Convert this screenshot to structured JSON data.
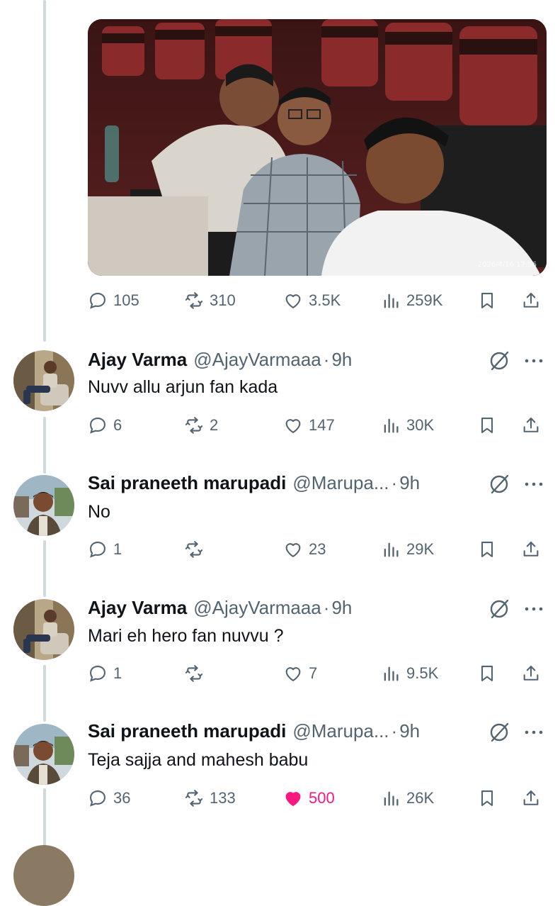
{
  "photo": {
    "timestamp": "2026/4/16 17:56"
  },
  "main_post": {
    "replies": "105",
    "reposts": "310",
    "likes": "3.5K",
    "views": "259K"
  },
  "replies": [
    {
      "name": "Ajay Varma",
      "handle": "@AjayVarmaaa",
      "time": "9h",
      "text": "Nuvv allu arjun fan kada",
      "stats": {
        "replies": "6",
        "reposts": "2",
        "likes": "147",
        "views": "30K"
      },
      "liked": false
    },
    {
      "name": "Sai praneeth marupadi",
      "handle": "@Marupa...",
      "time": "9h",
      "text": "No",
      "stats": {
        "replies": "1",
        "reposts": "",
        "likes": "23",
        "views": "29K"
      },
      "liked": false
    },
    {
      "name": "Ajay Varma",
      "handle": "@AjayVarmaaa",
      "time": "9h",
      "text": "Mari eh hero fan nuvvu ?",
      "stats": {
        "replies": "1",
        "reposts": "",
        "likes": "7",
        "views": "9.5K"
      },
      "liked": false
    },
    {
      "name": "Sai praneeth marupadi",
      "handle": "@Marupa...",
      "time": "9h",
      "text": "Teja sajja and mahesh babu",
      "stats": {
        "replies": "36",
        "reposts": "133",
        "likes": "500",
        "views": "26K"
      },
      "liked": true
    }
  ],
  "separator_dot": "·",
  "colors": {
    "muted": "#536471",
    "like_pink": "#f91880",
    "thread_line": "#cfd9de"
  },
  "icons": [
    "reply-icon",
    "repost-icon",
    "like-icon",
    "views-icon",
    "bookmark-icon",
    "share-icon",
    "grok-icon",
    "more-icon"
  ]
}
